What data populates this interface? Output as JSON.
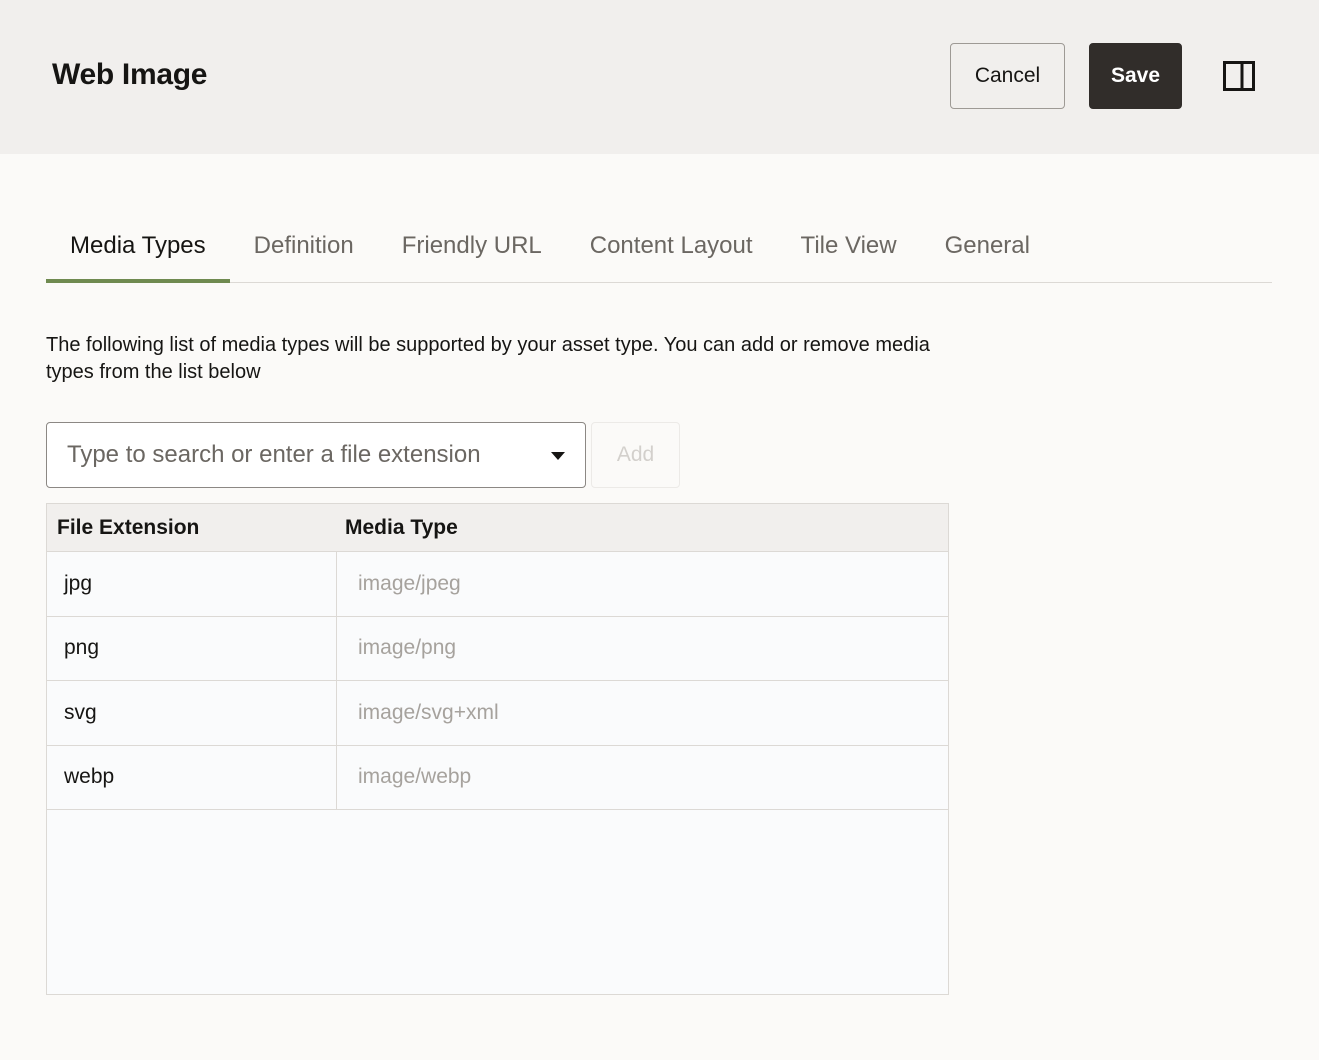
{
  "header": {
    "title": "Web Image",
    "cancel_label": "Cancel",
    "save_label": "Save",
    "panel_icon": "panel-split-icon"
  },
  "tabs": [
    {
      "label": "Media Types",
      "active": true
    },
    {
      "label": "Definition",
      "active": false
    },
    {
      "label": "Friendly URL",
      "active": false
    },
    {
      "label": "Content Layout",
      "active": false
    },
    {
      "label": "Tile View",
      "active": false
    },
    {
      "label": "General",
      "active": false
    }
  ],
  "description": "The following list of media types will be supported by your asset type. You can add or remove media types from the list below",
  "search": {
    "placeholder": "Type to search or enter a file extension",
    "value": "",
    "add_label": "Add"
  },
  "table": {
    "columns": [
      "File Extension",
      "Media Type"
    ],
    "rows": [
      {
        "ext": "jpg",
        "media": "image/jpeg"
      },
      {
        "ext": "png",
        "media": "image/png"
      },
      {
        "ext": "svg",
        "media": "image/svg+xml"
      },
      {
        "ext": "webp",
        "media": "image/webp"
      }
    ]
  },
  "colors": {
    "accent_tab": "#6f8a50",
    "save_bg": "#312d2a",
    "header_bg": "#f1efed"
  }
}
